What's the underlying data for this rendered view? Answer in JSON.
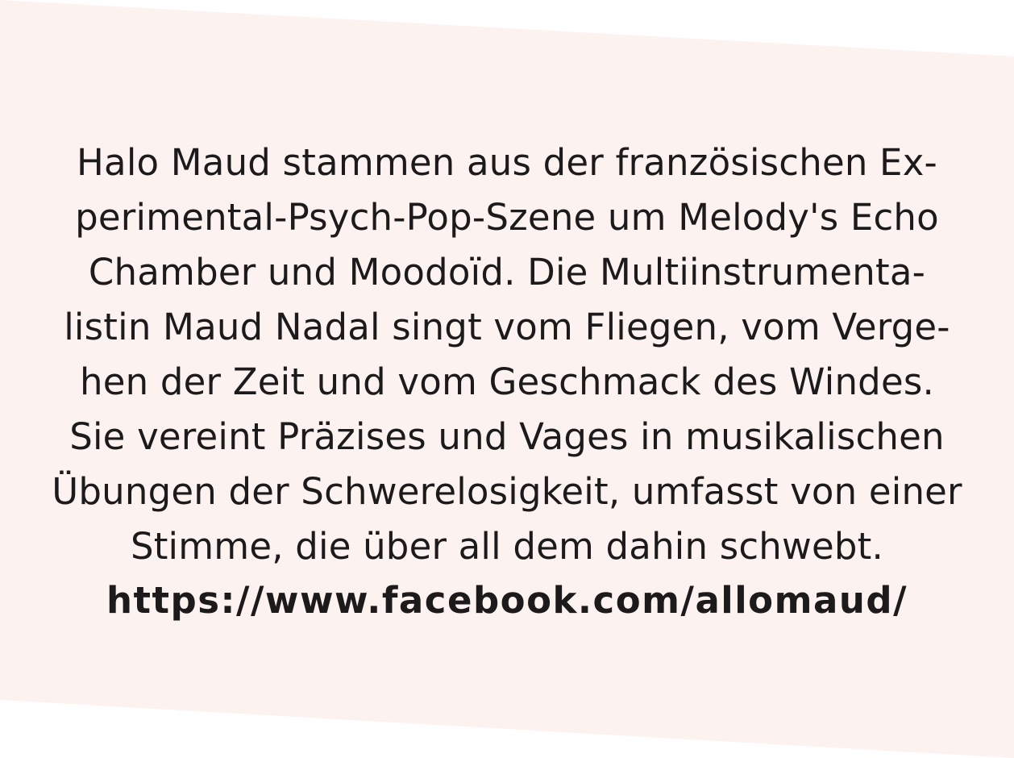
{
  "colors": {
    "panel_fill": "#fcf2f0",
    "page_background": "#ffffff",
    "text": "#1c1a1a"
  },
  "paragraph": {
    "lines": [
      "Halo Maud stammen aus der französischen Ex-",
      "perimental-Psych-Pop-Szene um Melody's Echo",
      "Chamber und Moodoïd. Die Multiinstrumenta-",
      "listin Maud Nadal singt vom Fliegen, vom Verge-",
      "hen der Zeit und vom Geschmack des Windes.",
      "Sie vereint Präzises und Vages in musikalischen",
      "Übungen der Schwerelosigkeit, umfasst von einer",
      "Stimme, die über all dem dahin schwebt."
    ]
  },
  "link": {
    "text": "https://www.facebook.com/allomaud/"
  }
}
